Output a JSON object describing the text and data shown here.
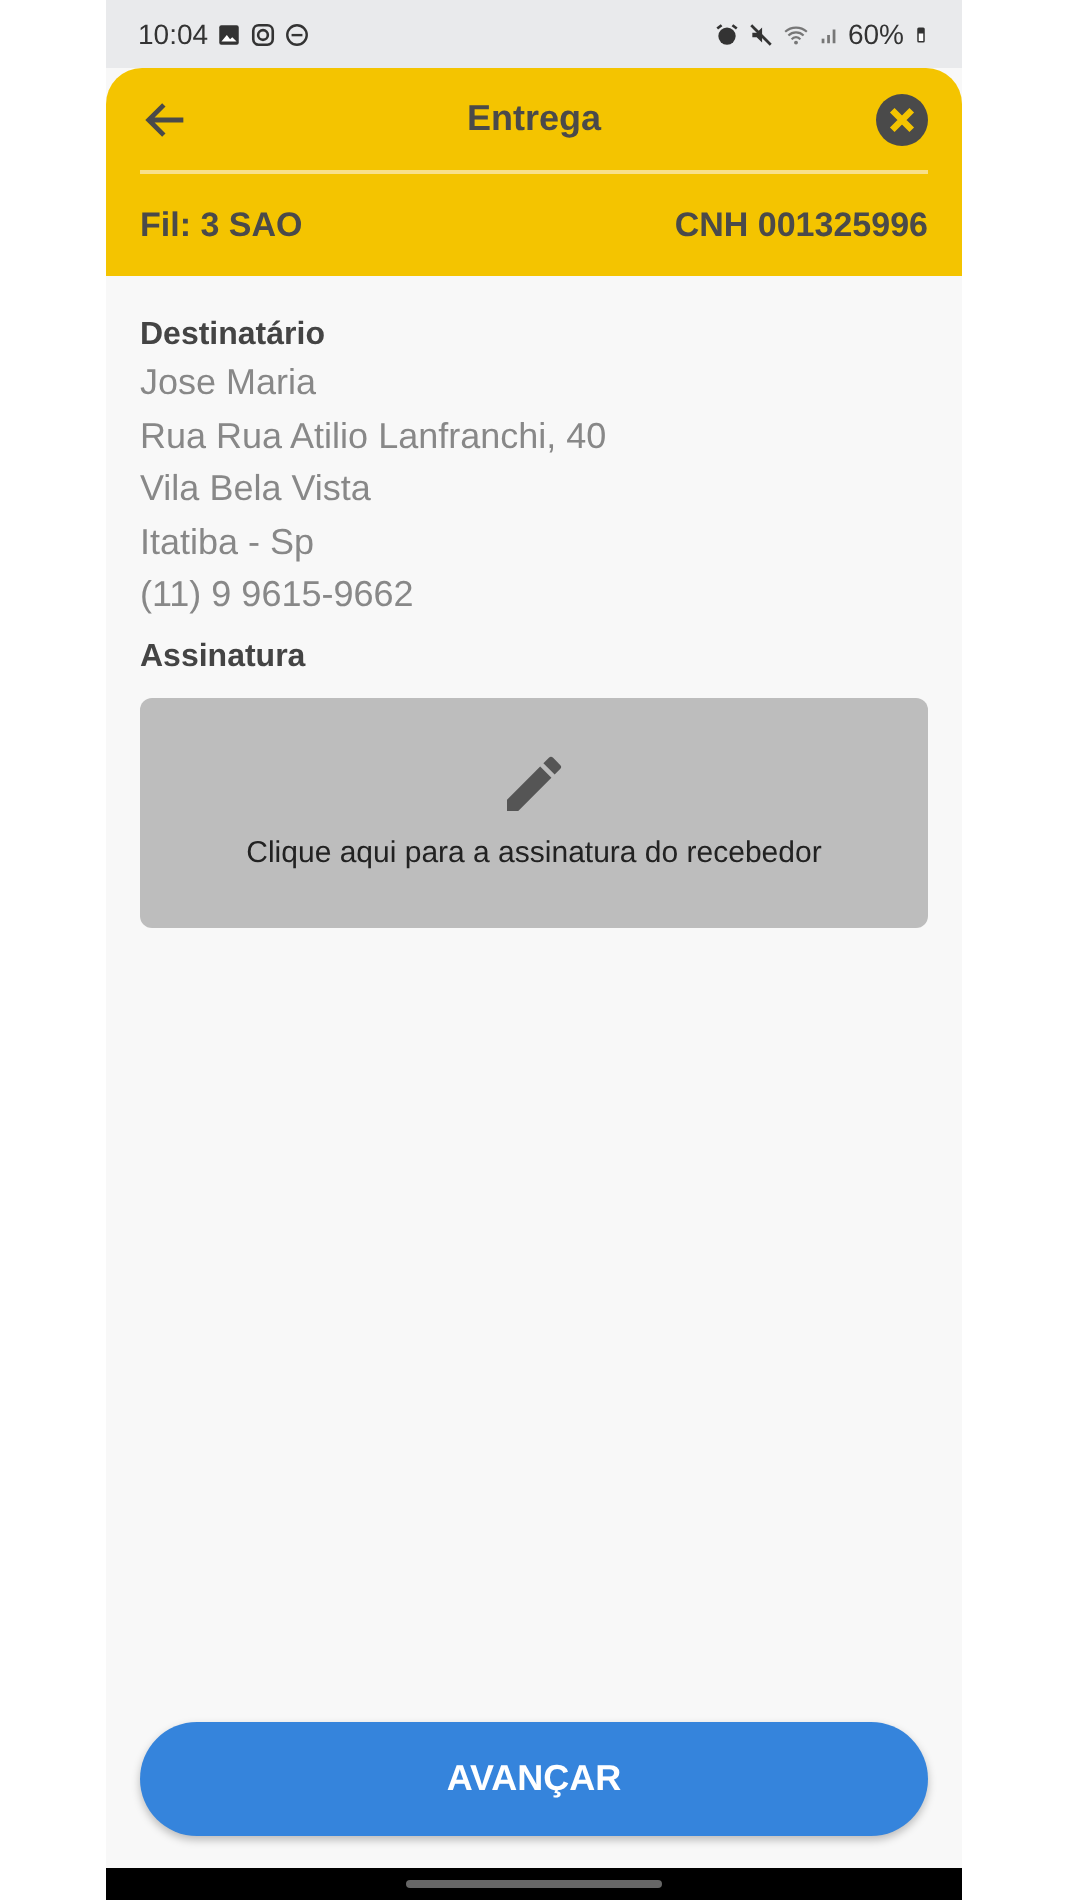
{
  "status_bar": {
    "time": "10:04",
    "battery": "60%"
  },
  "header": {
    "title": "Entrega",
    "branch": "Fil: 3 SAO",
    "license": "CNH 001325996"
  },
  "recipient": {
    "label": "Destinatário",
    "lines": [
      "Jose Maria",
      "Rua Rua Atilio Lanfranchi, 40",
      "Vila Bela Vista",
      "Itatiba - Sp",
      "(11) 9 9615-9662"
    ]
  },
  "signature": {
    "label": "Assinatura",
    "hint": "Clique aqui para a assinatura do recebedor"
  },
  "button": {
    "label": "AVANÇAR"
  }
}
